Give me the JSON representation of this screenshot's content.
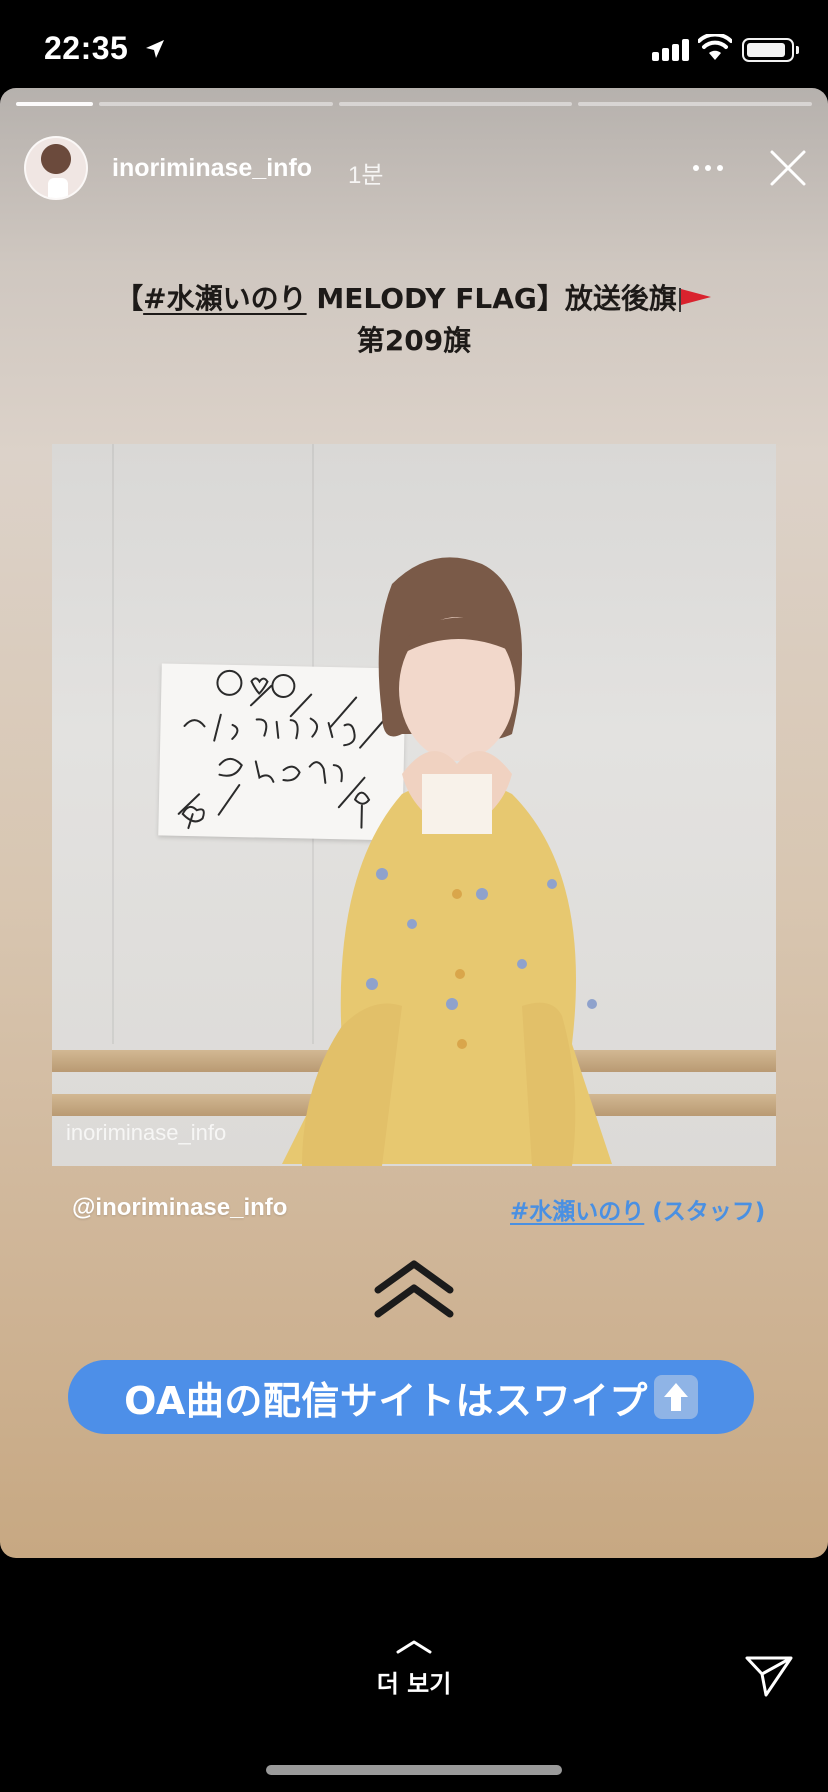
{
  "status_bar": {
    "time": "22:35",
    "location_icon": "location-arrow-icon",
    "signal_icon": "cellular-signal-icon",
    "wifi_icon": "wifi-icon",
    "battery_icon": "battery-icon"
  },
  "story": {
    "progress_segments": 4,
    "active_segment": 1,
    "username": "inoriminase_info",
    "time_ago": "1분",
    "more_icon": "more-horizontal-icon",
    "close_icon": "close-icon",
    "title": {
      "open_bracket": "【",
      "hashtag": "#水瀬いのり",
      "text": " MELODY FLAG】放送後旗",
      "flag_icon": "red-flag-icon",
      "line2": "第209旗"
    },
    "photo": {
      "watermark": "inoriminase_info"
    },
    "mention": "@inoriminase_info",
    "hashtag_link": {
      "tag": "#水瀬いのり",
      "suffix": " (スタッフ)"
    },
    "swipe_icon": "double-chevron-up-icon",
    "cta": {
      "label": "OA曲の配信サイトはスワイプ",
      "icon": "up-arrow-icon"
    }
  },
  "bottom_bar": {
    "see_more_label": "더 보기",
    "see_more_icon": "chevron-up-icon",
    "send_icon": "send-icon"
  },
  "colors": {
    "accent_blue": "#4d8fe8",
    "link_blue": "#4a90e2",
    "flag_red": "#d9232e"
  }
}
